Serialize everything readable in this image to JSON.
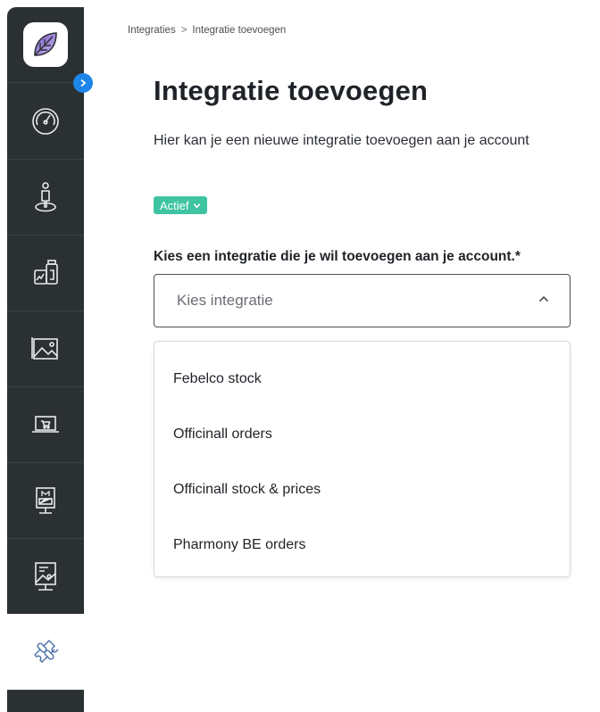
{
  "breadcrumb": {
    "items": [
      "Integraties",
      "Integratie toevoegen"
    ],
    "separator": ">"
  },
  "page": {
    "title": "Integratie toevoegen",
    "subtitle": "Hier kan je een nieuwe integratie toevoegen aan je account"
  },
  "status": {
    "label": "Actief",
    "color": "#3fc4a2"
  },
  "form": {
    "label": "Kies een integratie die je wil toevoegen aan je account.*",
    "select": {
      "placeholder": "Kies integratie",
      "expanded": true,
      "options": [
        "Febelco stock",
        "Officinall orders",
        "Officinall stock & prices",
        "Pharmony BE orders"
      ]
    }
  },
  "sidebar": {
    "background": "#2b3033",
    "accent": "#1d86e8",
    "items": [
      {
        "icon": "speedometer-icon",
        "active": false
      },
      {
        "icon": "person-pin-icon",
        "active": false
      },
      {
        "icon": "products-icon",
        "active": false
      },
      {
        "icon": "image-icon",
        "active": false
      },
      {
        "icon": "laptop-cart-icon",
        "active": false
      },
      {
        "icon": "monitor-m-icon",
        "active": false
      },
      {
        "icon": "display-image-icon",
        "active": false
      },
      {
        "icon": "puzzle-icon",
        "active": true
      }
    ]
  }
}
